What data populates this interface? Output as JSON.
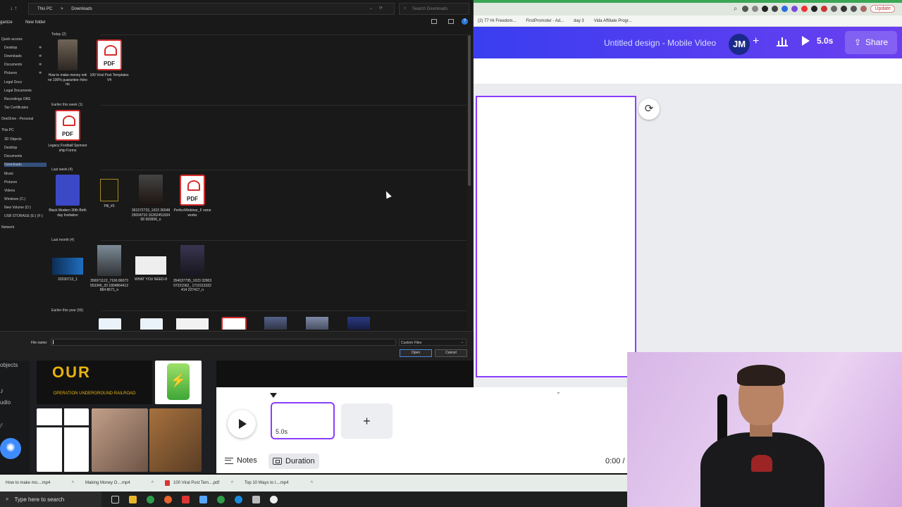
{
  "browser": {
    "zoom_icon": "search-icon",
    "update_label": "Update",
    "bookmarks": [
      "(2) 77 Hr Freedom...",
      "FirstPromoter - Ad...",
      "day 3",
      "Vida Affiliate Progr..."
    ]
  },
  "canva": {
    "design_title": "Untitled design - Mobile Video",
    "avatar_initials": "JM",
    "add_label": "+",
    "duration_label": "5.0s",
    "share_label": "Share",
    "accent": "#8b3dff"
  },
  "canva_left": {
    "rail_labels": [
      "objects",
      "udio"
    ],
    "ugr_logo": "OUR",
    "ugr_caption": "OPERATION UNDERGROUND RAILROAD"
  },
  "timeline": {
    "clip_label": "5.0s",
    "add_label": "+",
    "notes_label": "Notes",
    "duration_label": "Duration",
    "time_label": "0:00 /"
  },
  "dialog": {
    "path": [
      "This PC",
      ">",
      "Downloads"
    ],
    "search_placeholder": "Search Downloads",
    "organize_label": "ganize",
    "new_folder_label": "New folder",
    "help_label": "?",
    "nav_items": [
      {
        "label": "Quick access",
        "pinned": false
      },
      {
        "label": "Desktop",
        "pinned": true
      },
      {
        "label": "Downloads",
        "pinned": true
      },
      {
        "label": "Documents",
        "pinned": true
      },
      {
        "label": "Pictures",
        "pinned": true
      },
      {
        "label": "Legal Docs",
        "pinned": false
      },
      {
        "label": "Legal Documents",
        "pinned": false
      },
      {
        "label": "Recordings OBS",
        "pinned": false
      },
      {
        "label": "Tax Certificates",
        "pinned": false
      },
      {
        "label": "OneDrive - Personal",
        "pinned": false
      },
      {
        "label": "This PC",
        "pinned": false
      },
      {
        "label": "3D Objects",
        "pinned": false
      },
      {
        "label": "Desktop",
        "pinned": false
      },
      {
        "label": "Documents",
        "pinned": false
      },
      {
        "label": "Downloads",
        "pinned": false,
        "selected": true
      },
      {
        "label": "Music",
        "pinned": false
      },
      {
        "label": "Pictures",
        "pinned": false
      },
      {
        "label": "Videos",
        "pinned": false
      },
      {
        "label": "Windows (C:)",
        "pinned": false
      },
      {
        "label": "New Volume (D:)",
        "pinned": false
      },
      {
        "label": "USB STORAGE (E:) (F:)",
        "pinned": false
      },
      {
        "label": "Network",
        "pinned": false
      }
    ],
    "groups": [
      {
        "header": "Today (2)",
        "files": [
          {
            "name": "How to make money online 100% guarantee #shorts",
            "kind": "video"
          },
          {
            "name": "100 Viral Post Templates V4",
            "kind": "pdf"
          }
        ]
      },
      {
        "header": "Earlier this week (1)",
        "files": [
          {
            "name": "Legacy Football Sponsorship Forms",
            "kind": "pdf"
          }
        ]
      },
      {
        "header": "Last week (4)",
        "files": [
          {
            "name": "Black Modern 30th Birthday Invitation",
            "kind": "image-blue"
          },
          {
            "name": "Pill_#5",
            "kind": "image-gold"
          },
          {
            "name": "361572733_1023 3604825004710 1626245193458 993906_n",
            "kind": "image-dark"
          },
          {
            "name": "PerfectWebinar_F rameworks",
            "kind": "pdf"
          }
        ]
      },
      {
        "header": "Last month (4)",
        "files": [
          {
            "name": "20230713_1",
            "kind": "image-banner"
          },
          {
            "name": "356971122_7166 86073553340_20 1804864412884 8671_n",
            "kind": "image-street"
          },
          {
            "name": "WHAT YOU NEED-8",
            "kind": "image-white"
          },
          {
            "name": "354037795_1023 3290307221562_ 1710113322414 227417_n",
            "kind": "image-dark"
          }
        ]
      },
      {
        "header": "Earlier this year (56)",
        "files": []
      }
    ],
    "file_name_label": "File name:",
    "file_name_value": "",
    "file_type_value": "Custom Files",
    "open_label": "Open",
    "cancel_label": "Cancel"
  },
  "downloads_bar": [
    {
      "name": "How to make mo....mp4",
      "kind": "video"
    },
    {
      "name": "Making Money O....mp4",
      "kind": "video"
    },
    {
      "name": "100 Viral Post Tem....pdf",
      "kind": "pdf"
    },
    {
      "name": "Top 10 Ways to l....mp4",
      "kind": "video"
    }
  ],
  "taskbar": {
    "search_placeholder": "Type here to search"
  }
}
